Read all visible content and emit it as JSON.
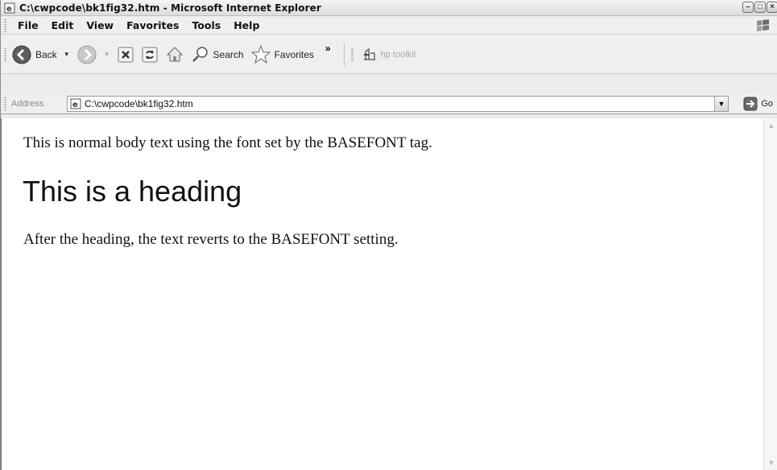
{
  "window": {
    "title": "C:\\cwpcode\\bk1fig32.htm - Microsoft Internet Explorer"
  },
  "menu": {
    "items": [
      "File",
      "Edit",
      "View",
      "Favorites",
      "Tools",
      "Help"
    ]
  },
  "toolbar": {
    "back_label": "Back",
    "search_label": "Search",
    "favorites_label": "Favorites",
    "overflow_label": "»",
    "hp_toolkit_label": "hp toolkit"
  },
  "address": {
    "label": "Address",
    "value": "C:\\cwpcode\\bk1fig32.htm",
    "go_label": "Go"
  },
  "page": {
    "paragraph1": "This is normal body text using the font set by the BASEFONT tag.",
    "heading": "This is a heading",
    "paragraph2": "After the heading, the text reverts to the BASEFONT setting."
  }
}
